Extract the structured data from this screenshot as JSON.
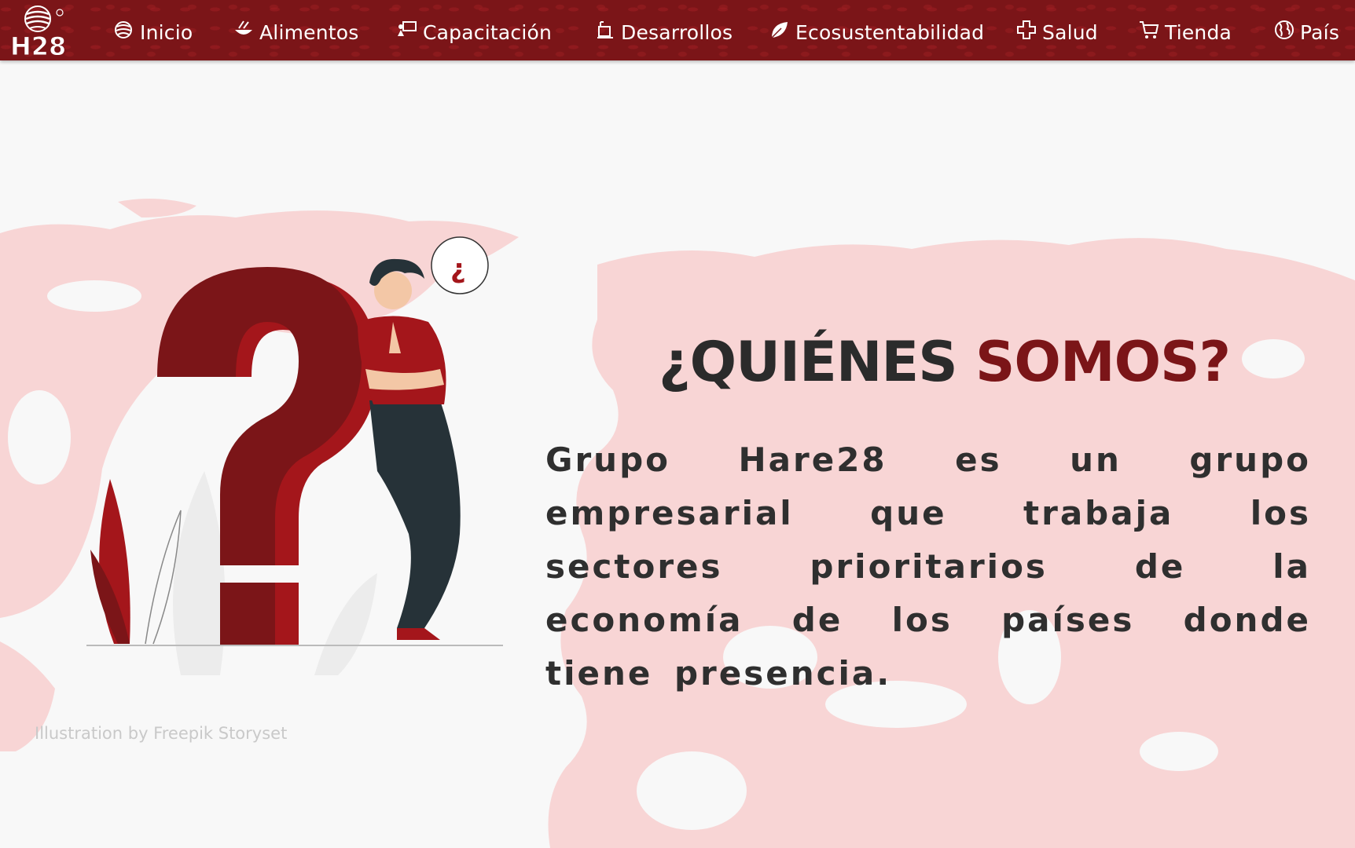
{
  "brand": {
    "logo_text": "H28",
    "registered_mark": "®"
  },
  "nav": {
    "items": [
      {
        "label": "Inicio",
        "icon": "home-leaf-icon"
      },
      {
        "label": "Alimentos",
        "icon": "food-bowl-icon"
      },
      {
        "label": "Capacitación",
        "icon": "training-board-icon"
      },
      {
        "label": "Desarrollos",
        "icon": "development-device-icon"
      },
      {
        "label": "Ecosustentabilidad",
        "icon": "leaf-icon"
      },
      {
        "label": "Salud",
        "icon": "medical-cross-icon"
      },
      {
        "label": "Tienda",
        "icon": "shopping-cart-icon"
      },
      {
        "label": "País",
        "icon": "globe-icon"
      }
    ]
  },
  "hero": {
    "heading_part1": "¿QUIÉNES",
    "heading_part2": "SOMOS?",
    "description": "Grupo Hare28 es un grupo empresarial que trabaja los sectores prioritarios de la economía de los países donde tiene presencia.",
    "bubble_mark": "¿",
    "credit": "Illustration by Freepik Storyset"
  },
  "colors": {
    "primary": "#7b1518",
    "accent_red": "#a4161b",
    "map_pink": "#f8d5d5",
    "text_dark": "#2b2b2b",
    "background": "#f8f8f8"
  }
}
